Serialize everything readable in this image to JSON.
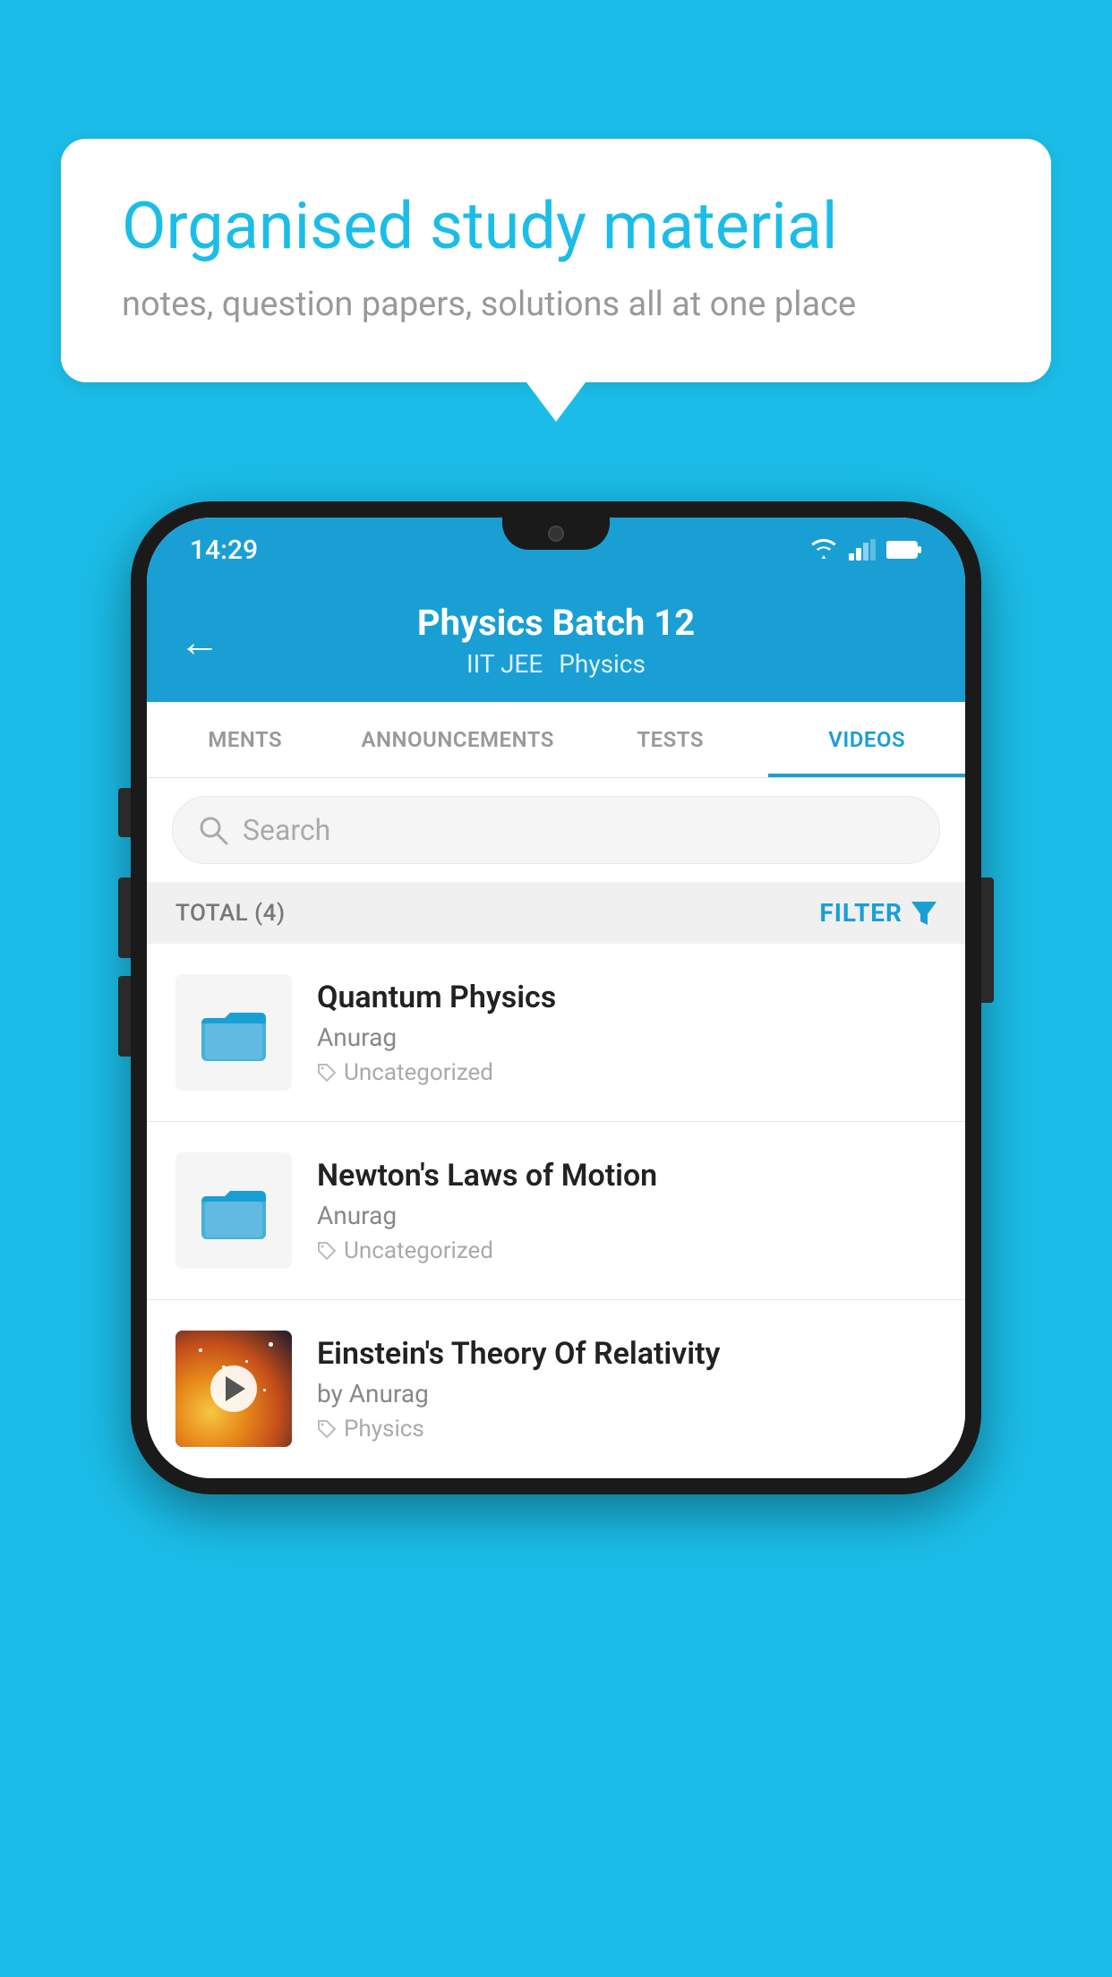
{
  "background_color": "#1bbde8",
  "bubble": {
    "title": "Organised study material",
    "subtitle": "notes, question papers, solutions all at one place"
  },
  "status_bar": {
    "time": "14:29",
    "icons": [
      "wifi",
      "signal",
      "battery"
    ]
  },
  "header": {
    "back_label": "←",
    "title": "Physics Batch 12",
    "subtitle_1": "IIT JEE",
    "subtitle_2": "Physics"
  },
  "tabs": [
    {
      "label": "MENTS",
      "active": false
    },
    {
      "label": "ANNOUNCEMENTS",
      "active": false
    },
    {
      "label": "TESTS",
      "active": false
    },
    {
      "label": "VIDEOS",
      "active": true
    }
  ],
  "search": {
    "placeholder": "Search"
  },
  "filter_bar": {
    "total_label": "TOTAL (4)",
    "filter_label": "FILTER"
  },
  "videos": [
    {
      "title": "Quantum Physics",
      "author": "Anurag",
      "tag": "Uncategorized",
      "has_thumbnail": false
    },
    {
      "title": "Newton's Laws of Motion",
      "author": "Anurag",
      "tag": "Uncategorized",
      "has_thumbnail": false
    },
    {
      "title": "Einstein's Theory Of Relativity",
      "author": "by Anurag",
      "tag": "Physics",
      "has_thumbnail": true
    }
  ]
}
